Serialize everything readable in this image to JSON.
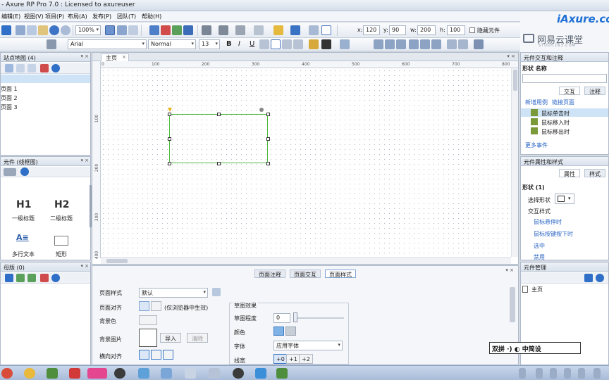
{
  "window": {
    "title": "- Axure RP Pro 7.0 : Licensed to axureuser"
  },
  "menu": [
    "编辑(E)",
    "视图(V)",
    "项目(P)",
    "布局(A)",
    "发布(P)",
    "团队(T)",
    "帮助(H)"
  ],
  "toolbar": {
    "zoom": "100%",
    "font": "Arial",
    "style": "Normal",
    "size": "13",
    "x_label": "x:",
    "x": "120",
    "y_label": "y:",
    "y": "90",
    "w_label": "w:",
    "w": "200",
    "h_label": "h:",
    "h": "100",
    "hidden_label": "隐藏元件",
    "bold": "B",
    "italic": "I",
    "underline": "U"
  },
  "watermark": {
    "brand": "iAxure.com",
    "site": "网易云课堂",
    "site_sub": "STUDY.163.COM"
  },
  "sitemap": {
    "title": "站点地图 (4)",
    "pages": [
      "页面 1",
      "页面 2",
      "页面 3"
    ]
  },
  "widgets": {
    "title": "元件 (线框图)",
    "items": [
      {
        "glyph": "H1",
        "label": "一级标题"
      },
      {
        "glyph": "H2",
        "label": "二级标题"
      },
      {
        "glyph": "A≡",
        "label": "多行文本"
      },
      {
        "glyph": "",
        "label": "矩形"
      }
    ]
  },
  "masters": {
    "title": "母版 (0)"
  },
  "canvas": {
    "tab": "主页",
    "ruler_h": [
      "0",
      "100",
      "200",
      "300",
      "400",
      "500",
      "600",
      "700",
      "800"
    ],
    "ruler_v": [
      "100",
      "200",
      "300",
      "400"
    ]
  },
  "bottom": {
    "tabs": [
      "页面注释",
      "页面交互",
      "页面样式"
    ],
    "page_style_label": "页面样式",
    "page_style_value": "默认",
    "align_label": "页面对齐",
    "align_note": "(仅浏览器中生效)",
    "bgcolor_label": "背景色",
    "bgimage_label": "背景图片",
    "import_btn": "导入",
    "clear_btn": "清除",
    "halign_label": "横向对齐",
    "sketch_title": "草图效果",
    "sketch_degree_label": "草图程度",
    "sketch_degree_value": "0",
    "color_label": "颜色",
    "font_label": "字体",
    "font_value": "应用字体",
    "line_label": "线宽",
    "line_opts": [
      "+0",
      "+1",
      "+2"
    ]
  },
  "right": {
    "interaction_title": "元件交互和注释",
    "shape_name_label": "形状 名称",
    "tabs": [
      "交互",
      "注释"
    ],
    "links": [
      "新增用例",
      "链接页面"
    ],
    "events": [
      "鼠标单击时",
      "鼠标移入时",
      "鼠标移出时"
    ],
    "more_events": "更多事件",
    "props_title": "元件属性和样式",
    "prop_tabs": [
      "属性",
      "样式"
    ],
    "shape_section": "形状 (1)",
    "select_shape_label": "选择形状",
    "interaction_style": "交互样式",
    "style_links": [
      "鼠标悬停时",
      "鼠标按键按下时",
      "选中",
      "禁用"
    ],
    "manager_title": "元件管理",
    "manager_item": "主页"
  },
  "ime": {
    "text": "双拼 ·) ◐ 中简设"
  },
  "colors": {
    "accent": "#4cbb3c",
    "link": "#2a65c4",
    "panel_head": "#d9e1ec",
    "selection": "#cfe3f7"
  }
}
